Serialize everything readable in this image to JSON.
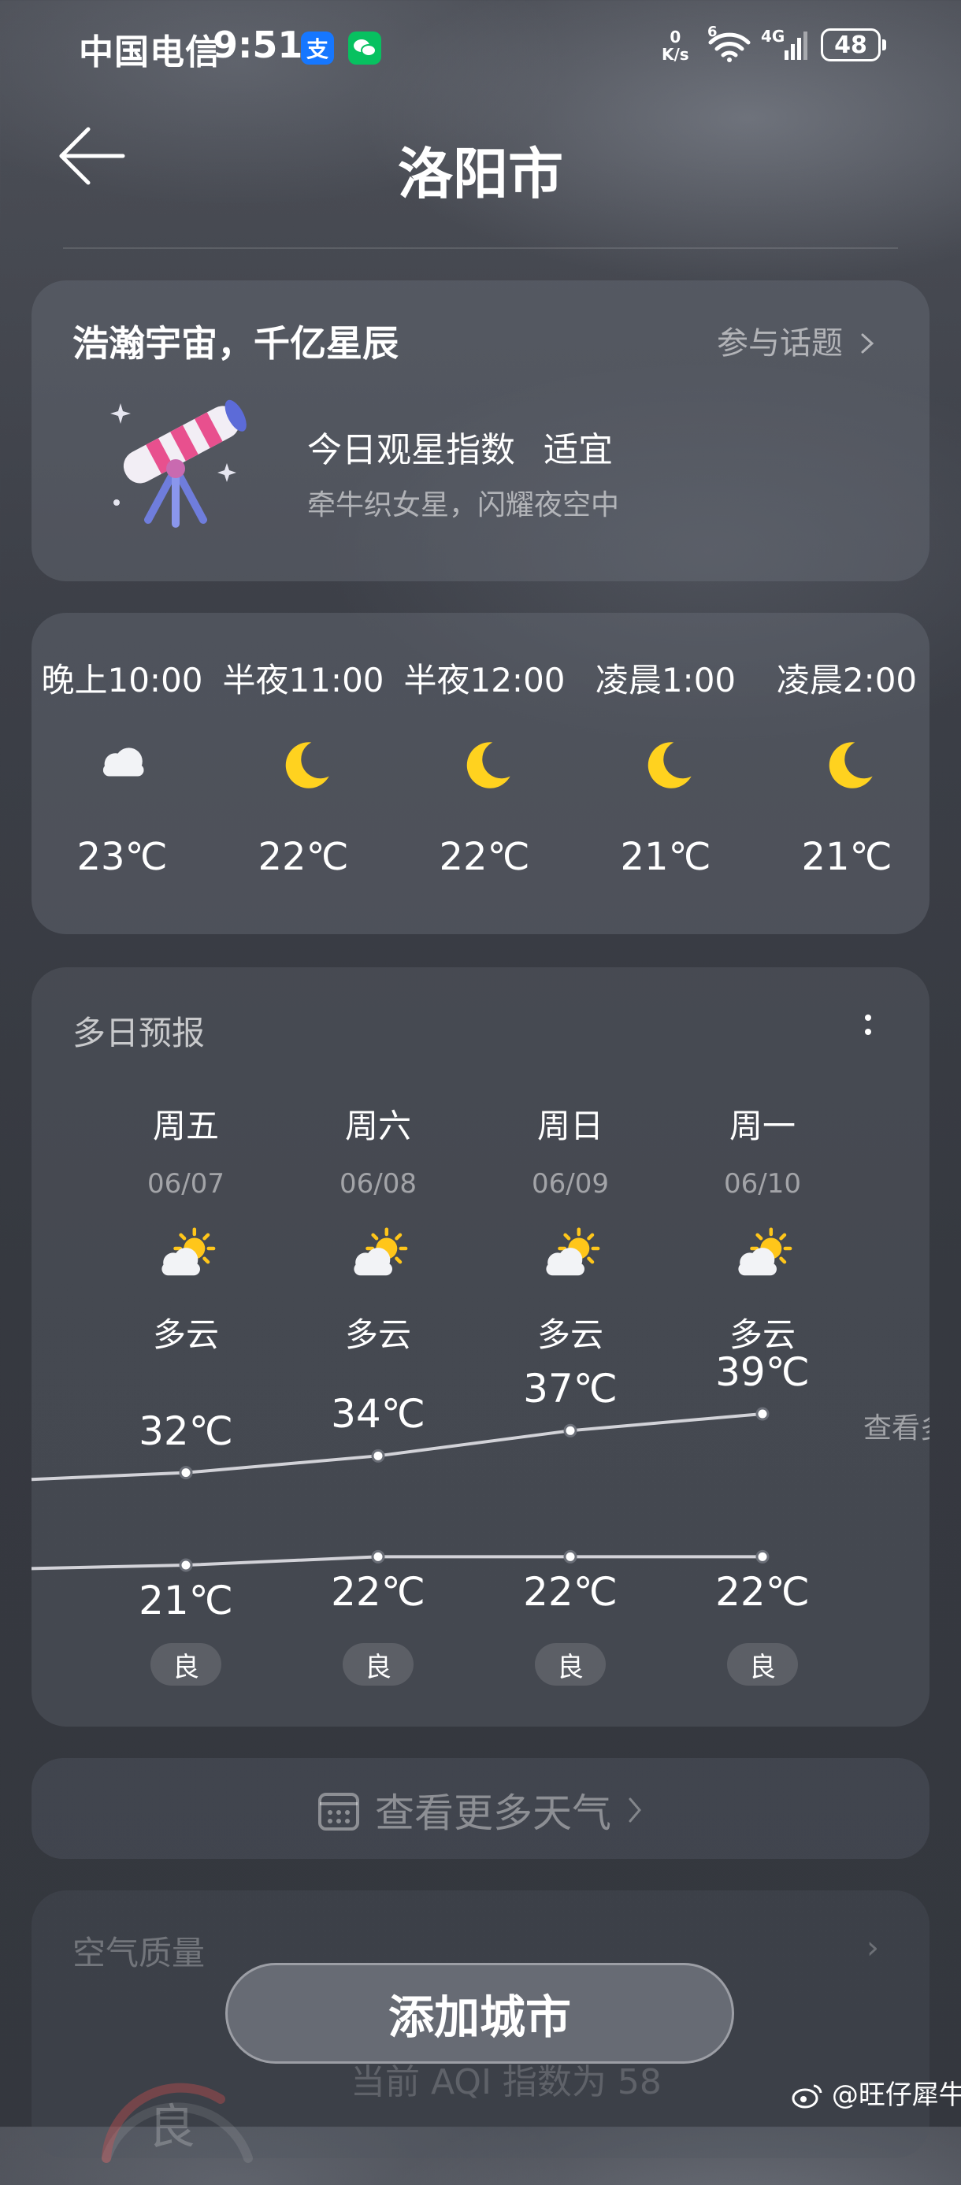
{
  "status_bar": {
    "carrier": "中国电信",
    "time": "9:51",
    "alipay_glyph": "支",
    "net_speed_value": "0",
    "net_speed_unit": "K/s",
    "wifi_label": "6",
    "cell_label": "4G",
    "battery": "48"
  },
  "header": {
    "title": "洛阳市"
  },
  "stargaze": {
    "headline": "浩瀚宇宙，千亿星辰",
    "join_topic": "参与话题",
    "index_label": "今日观星指数",
    "index_value": "适宜",
    "description": "牵牛织女星，闪耀夜空中"
  },
  "hourly": [
    {
      "time": "晚上10:00",
      "icon": "cloudy-icon",
      "temp": "23℃"
    },
    {
      "time": "半夜11:00",
      "icon": "moon-icon",
      "temp": "22℃"
    },
    {
      "time": "半夜12:00",
      "icon": "moon-icon",
      "temp": "22℃"
    },
    {
      "time": "凌晨1:00",
      "icon": "moon-icon",
      "temp": "21℃"
    },
    {
      "time": "凌晨2:00",
      "icon": "moon-icon",
      "temp": "21℃"
    }
  ],
  "forecast": {
    "title": "多日预报",
    "see_more_edge": "查看多",
    "days": [
      {
        "name": "周五",
        "date": "06/07",
        "icon": "partly-cloudy-icon",
        "condition": "多云",
        "high": "32℃",
        "low": "21℃",
        "aqi": "良"
      },
      {
        "name": "周六",
        "date": "06/08",
        "icon": "partly-cloudy-icon",
        "condition": "多云",
        "high": "34℃",
        "low": "22℃",
        "aqi": "良"
      },
      {
        "name": "周日",
        "date": "06/09",
        "icon": "partly-cloudy-icon",
        "condition": "多云",
        "high": "37℃",
        "low": "22℃",
        "aqi": "良"
      },
      {
        "name": "周一",
        "date": "06/10",
        "icon": "partly-cloudy-icon",
        "condition": "多云",
        "high": "39℃",
        "low": "22℃",
        "aqi": "良"
      }
    ]
  },
  "more_weather": {
    "label": "查看更多天气"
  },
  "air_quality": {
    "title": "空气质量",
    "level": "良",
    "description": "当前 AQI 指数为 58"
  },
  "add_city": {
    "label": "添加城市"
  },
  "watermark": {
    "text": "@旺仔犀牛"
  }
}
